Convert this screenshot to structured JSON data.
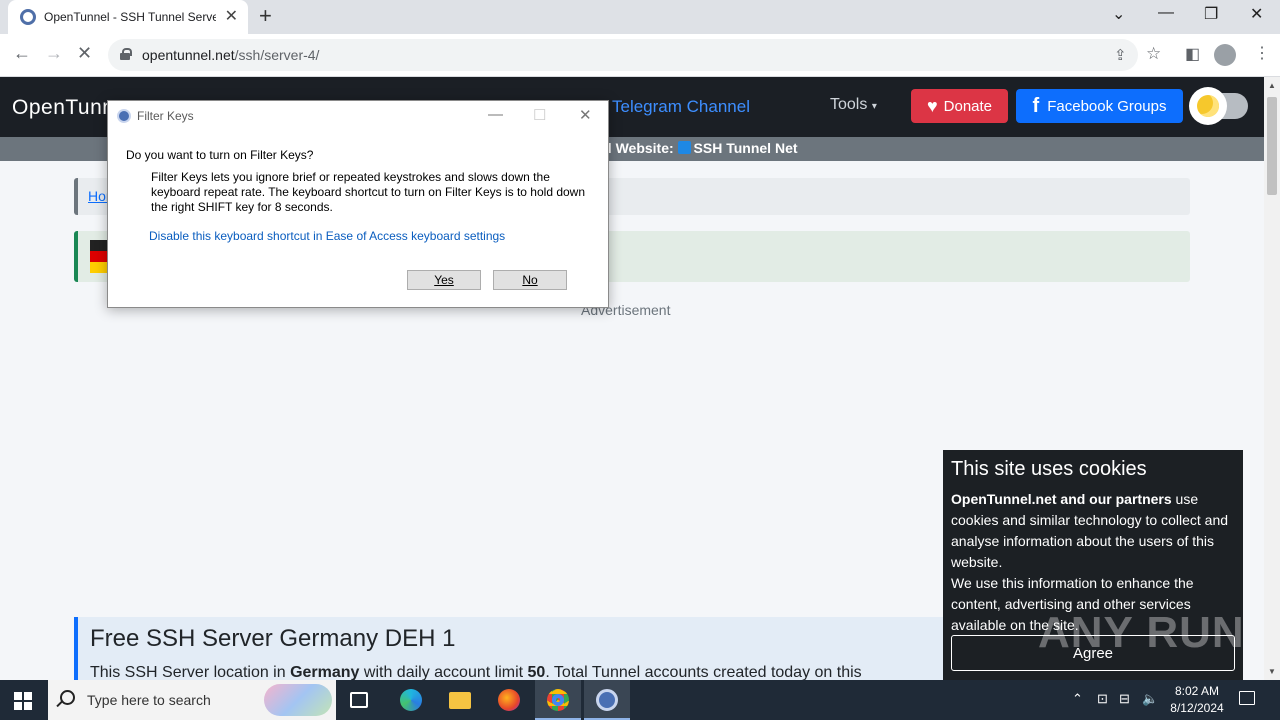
{
  "browser": {
    "tab_title": "OpenTunnel - SSH Tunnel Server",
    "url_host": "opentunnel.net",
    "url_path": "/ssh/server-4/"
  },
  "site": {
    "logo_text": "OpenTunn",
    "telegram_link": "Telegram Channel",
    "tools_label": "Tools",
    "donate_label": "Donate",
    "facebook_label": "Facebook Groups",
    "subbar_text": "el Website:",
    "subbar_link": "SSH Tunnel Net",
    "breadcrumb_home": "Hom",
    "advertisement_label": "Advertisement",
    "server_title": "Free SSH Server Germany DEH 1",
    "server_desc_1": "This SSH Server location in ",
    "server_desc_country": "Germany",
    "server_desc_2": " with daily account limit ",
    "server_desc_limit": "50",
    "server_desc_3": ". Total Tunnel accounts created today on this"
  },
  "cookie": {
    "title": "This site uses cookies",
    "text_bold": "OpenTunnel.net and our partners",
    "text_1": " use cookies and similar technology to collect and analyse information about the users of this website.",
    "text_2": "We use this information to enhance the content, advertising and other services available on the site.",
    "agree_label": "Agree"
  },
  "watermark": "ANY RUN",
  "dialog": {
    "title": "Filter Keys",
    "question": "Do you want to turn on Filter Keys?",
    "description": "Filter Keys lets you ignore brief or repeated keystrokes and slows down the keyboard repeat rate.  The keyboard shortcut to turn on Filter Keys is to hold down the right SHIFT key for 8 seconds.",
    "link": "Disable this keyboard shortcut in Ease of Access keyboard settings",
    "yes_label": "Yes",
    "no_label": "No"
  },
  "taskbar": {
    "search_placeholder": "Type here to search",
    "time": "8:02 AM",
    "date": "8/12/2024"
  },
  "colors": {
    "donate": "#dc3545",
    "facebook": "#0d6efd",
    "telegram": "#3d8eff",
    "header_bg": "#1b1f25",
    "cookie_bg": "#1c2024"
  }
}
